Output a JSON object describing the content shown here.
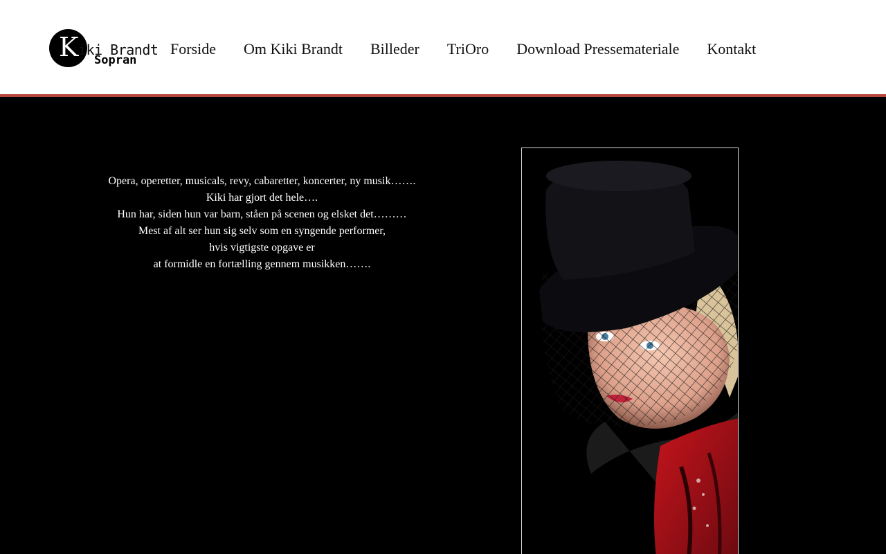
{
  "logo": {
    "monogram": "K",
    "name": "iki Brandt",
    "subtitle": "Sopran"
  },
  "nav": {
    "items": [
      {
        "label": "Forside"
      },
      {
        "label": "Om Kiki Brandt"
      },
      {
        "label": "Billeder"
      },
      {
        "label": "TriOro"
      },
      {
        "label": "Download Pressemateriale"
      },
      {
        "label": "Kontakt"
      }
    ]
  },
  "intro": {
    "lines": [
      "Opera, operetter, musicals, revy, cabaretter, koncerter, ny musik…….",
      "Kiki har gjort det hele….",
      "Hun har, siden hun var barn, ståen på scenen og elsket det………",
      "Mest af alt ser hun sig selv som en syngende performer,",
      "hvis vigtigste opgave er",
      "at formidle en fortælling gennem musikken……."
    ]
  },
  "colors": {
    "accent": "#b8463c",
    "background": "#000000",
    "header": "#ffffff"
  }
}
